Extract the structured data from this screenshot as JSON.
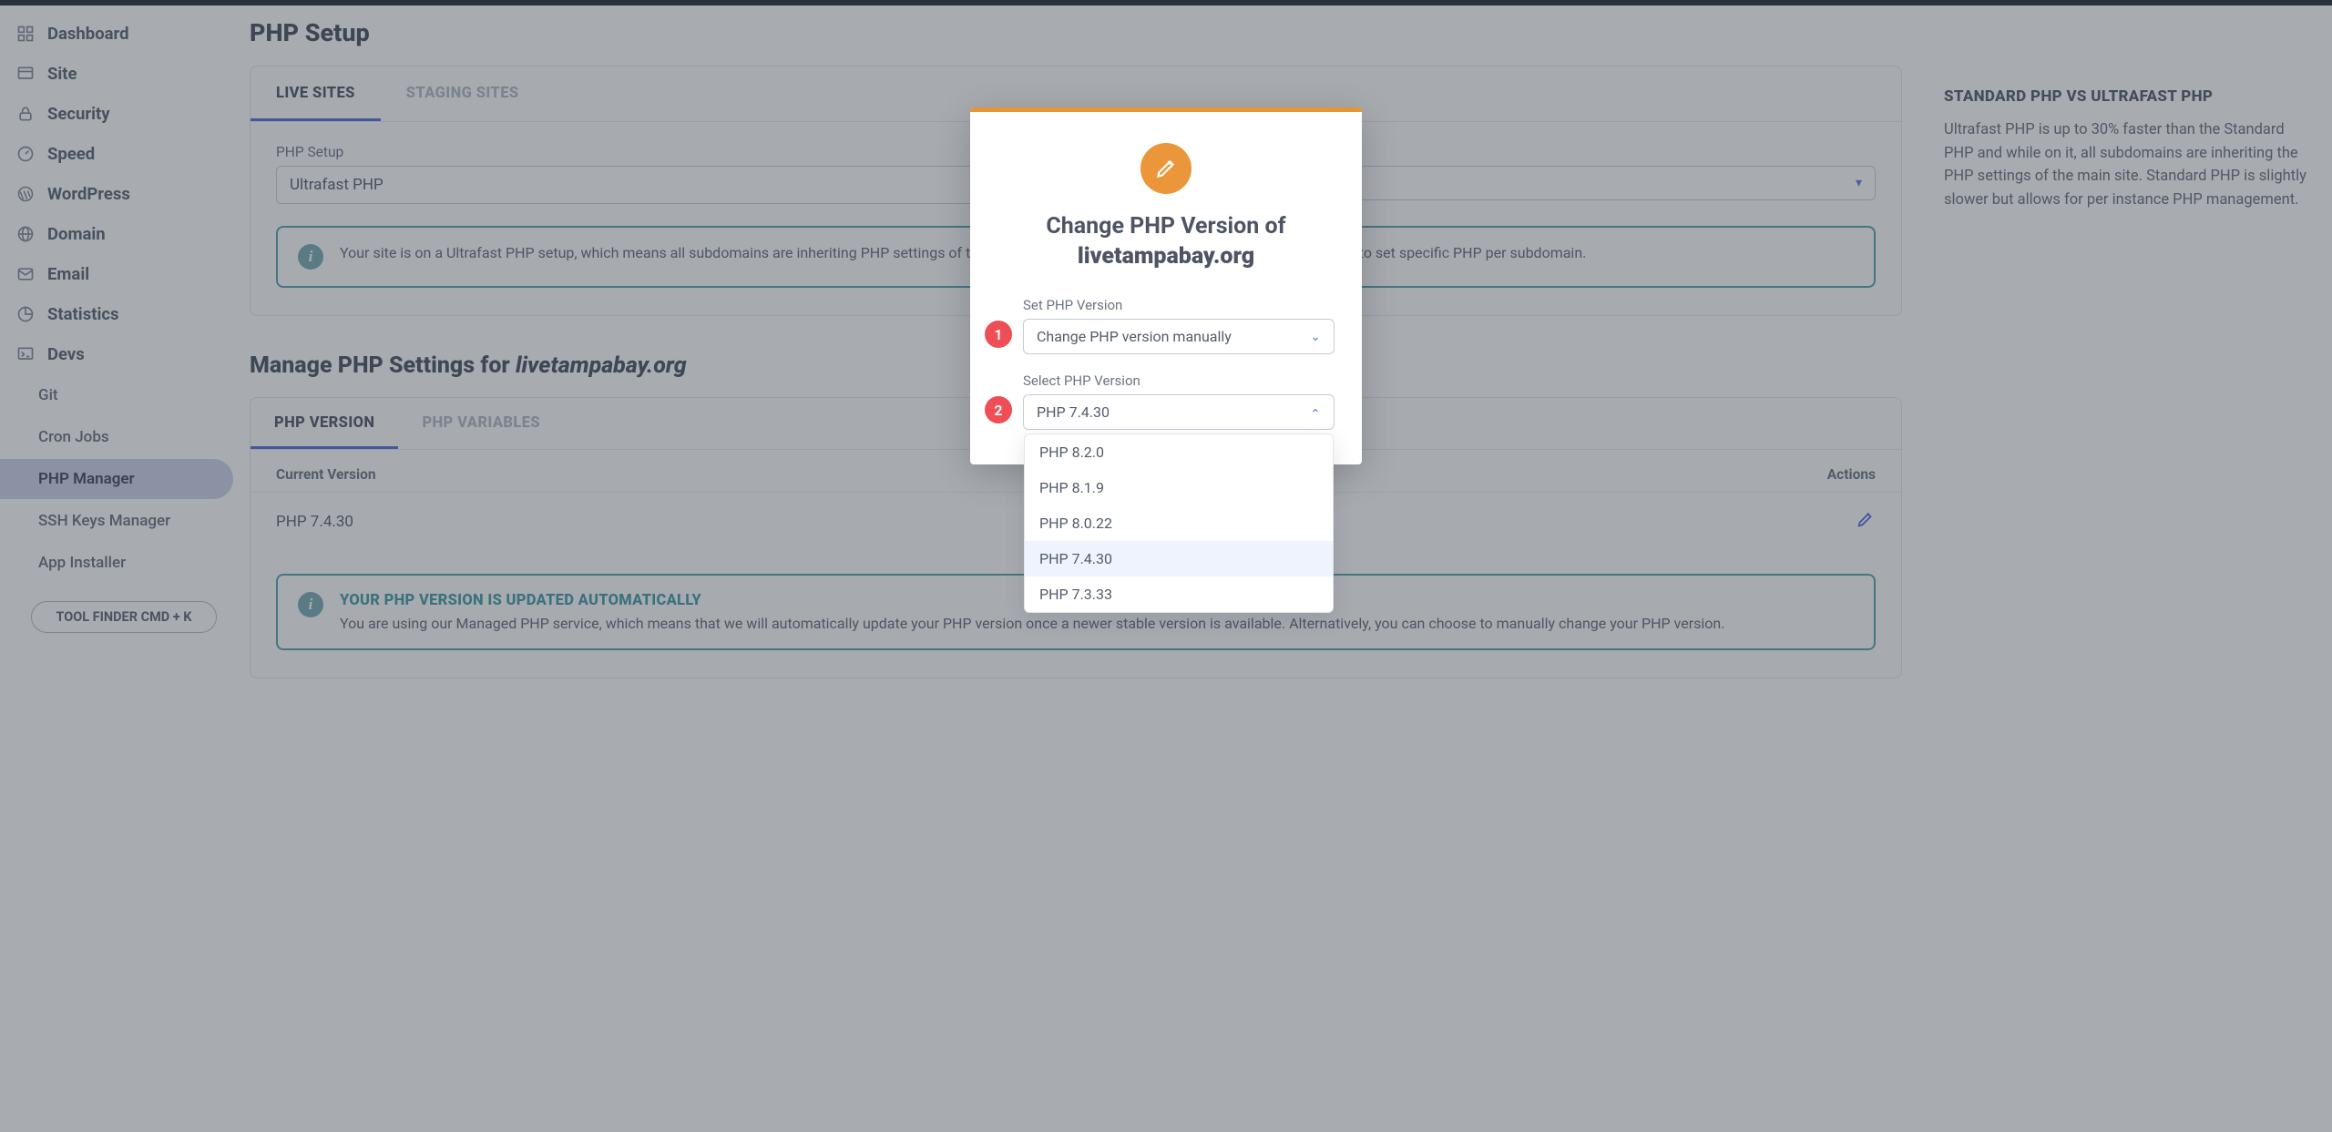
{
  "sidebar": {
    "items": [
      {
        "label": "Dashboard"
      },
      {
        "label": "Site"
      },
      {
        "label": "Security"
      },
      {
        "label": "Speed"
      },
      {
        "label": "WordPress"
      },
      {
        "label": "Domain"
      },
      {
        "label": "Email"
      },
      {
        "label": "Statistics"
      },
      {
        "label": "Devs"
      }
    ],
    "devs_children": [
      {
        "label": "Git"
      },
      {
        "label": "Cron Jobs"
      },
      {
        "label": "PHP Manager"
      },
      {
        "label": "SSH Keys Manager"
      },
      {
        "label": "App Installer"
      }
    ],
    "toolfinder": "TOOL FINDER CMD + K"
  },
  "page": {
    "title": "PHP Setup",
    "tabs": {
      "live": "LIVE SITES",
      "staging": "STAGING SITES"
    },
    "setup": {
      "label": "PHP Setup",
      "value": "Ultrafast PHP",
      "second_value": ""
    },
    "setup_info": "Your site is on a Ultrafast PHP setup, which means all subdomains are inheriting PHP settings of the primary site domain. Switch to Standard PHP if you need to set specific PHP per subdomain.",
    "section_title_prefix": "Manage PHP Settings for ",
    "section_title_site": "livetampabay.org",
    "tabs2": {
      "version": "PHP VERSION",
      "variables": "PHP VARIABLES"
    },
    "table": {
      "head_version": "Current Version",
      "head_actions": "Actions",
      "row_version": "PHP 7.4.30"
    },
    "auto_info": {
      "title": "YOUR PHP VERSION IS UPDATED AUTOMATICALLY",
      "body": "You are using our Managed PHP service, which means that we will automatically update your PHP version once a newer stable version is available. Alternatively, you can choose to manually change your PHP version."
    }
  },
  "right": {
    "heading": "STANDARD PHP VS ULTRAFAST PHP",
    "body": "Ultrafast PHP is up to 30% faster than the Standard PHP and while on it, all subdomains are inheriting the PHP settings of the main site. Standard PHP is slightly slower but allows for per instance PHP management."
  },
  "modal": {
    "title_prefix": "Change PHP Version of",
    "title_site": "livetampabay.org",
    "field1": {
      "label": "Set PHP Version",
      "value": "Change PHP version manually"
    },
    "field2": {
      "label": "Select PHP Version",
      "value": "PHP 7.4.30"
    },
    "options": [
      "PHP 8.2.0",
      "PHP 8.1.9",
      "PHP 8.0.22",
      "PHP 7.4.30",
      "PHP 7.3.33"
    ],
    "selected_option": "PHP 7.4.30",
    "steps": {
      "one": "1",
      "two": "2"
    }
  }
}
